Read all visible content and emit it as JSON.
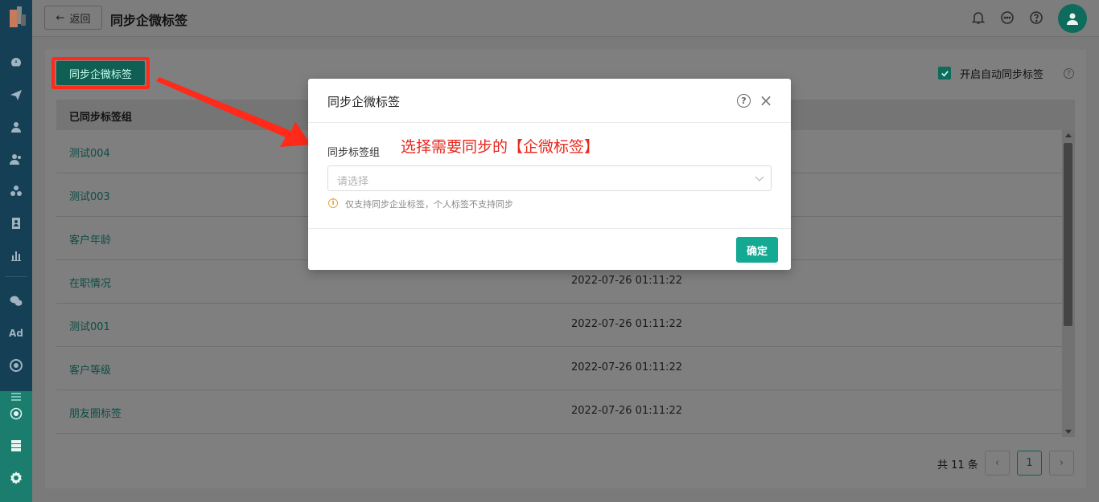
{
  "header": {
    "back_label": "返回",
    "title": "同步企微标签",
    "icons": [
      "bell-icon",
      "message-icon",
      "help-icon",
      "user-icon"
    ]
  },
  "sidebar": {
    "icons": [
      "dashboard-icon",
      "send-icon",
      "user-icon",
      "users-icon",
      "group-icon",
      "contact-card-icon",
      "chart-icon",
      "wechat-icon",
      "ad-icon",
      "target-icon",
      "list-icon",
      "network-icon",
      "server-icon",
      "gear-icon"
    ],
    "ad_label": "Ad"
  },
  "toolbar": {
    "sync_button": "同步企微标签",
    "auto_sync_label": "开启自动同步标签",
    "auto_sync_checked": true
  },
  "table": {
    "columns": [
      "已同步标签组",
      ""
    ],
    "rows": [
      {
        "name": "测试004",
        "time": ""
      },
      {
        "name": "测试003",
        "time": ""
      },
      {
        "name": "客户年龄",
        "time": ""
      },
      {
        "name": "在职情况",
        "time": "2022-07-26 01:11:22"
      },
      {
        "name": "测试001",
        "time": "2022-07-26 01:11:22"
      },
      {
        "name": "客户等级",
        "time": "2022-07-26 01:11:22"
      },
      {
        "name": "朋友圈标签",
        "time": "2022-07-26 01:11:22"
      }
    ]
  },
  "pagination": {
    "total_text": "共 11 条",
    "current_page": "1",
    "prev": "‹",
    "next": "›"
  },
  "modal": {
    "title": "同步企微标签",
    "field_label": "同步标签组",
    "annotation": "选择需要同步的【企微标签】",
    "select_placeholder": "请选择",
    "tip": "仅支持同步企业标签，个人标签不支持同步",
    "confirm": "确定"
  },
  "colors": {
    "accent": "#13a992",
    "annotation_red": "#e8281c",
    "sidebar": "#153f55"
  }
}
